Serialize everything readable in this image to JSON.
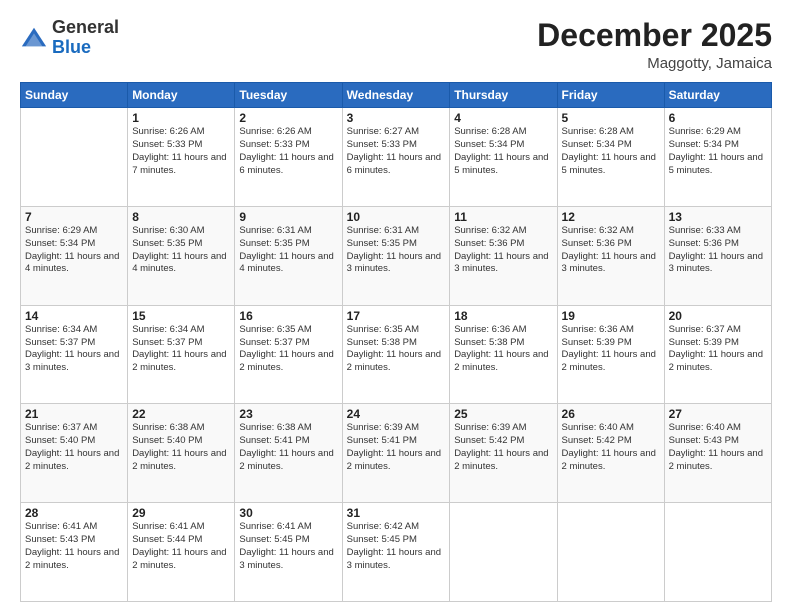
{
  "header": {
    "logo_general": "General",
    "logo_blue": "Blue",
    "month_title": "December 2025",
    "location": "Maggotty, Jamaica"
  },
  "weekdays": [
    "Sunday",
    "Monday",
    "Tuesday",
    "Wednesday",
    "Thursday",
    "Friday",
    "Saturday"
  ],
  "weeks": [
    [
      {
        "day": "",
        "sunrise": "",
        "sunset": "",
        "daylight": ""
      },
      {
        "day": "1",
        "sunrise": "Sunrise: 6:26 AM",
        "sunset": "Sunset: 5:33 PM",
        "daylight": "Daylight: 11 hours and 7 minutes."
      },
      {
        "day": "2",
        "sunrise": "Sunrise: 6:26 AM",
        "sunset": "Sunset: 5:33 PM",
        "daylight": "Daylight: 11 hours and 6 minutes."
      },
      {
        "day": "3",
        "sunrise": "Sunrise: 6:27 AM",
        "sunset": "Sunset: 5:33 PM",
        "daylight": "Daylight: 11 hours and 6 minutes."
      },
      {
        "day": "4",
        "sunrise": "Sunrise: 6:28 AM",
        "sunset": "Sunset: 5:34 PM",
        "daylight": "Daylight: 11 hours and 5 minutes."
      },
      {
        "day": "5",
        "sunrise": "Sunrise: 6:28 AM",
        "sunset": "Sunset: 5:34 PM",
        "daylight": "Daylight: 11 hours and 5 minutes."
      },
      {
        "day": "6",
        "sunrise": "Sunrise: 6:29 AM",
        "sunset": "Sunset: 5:34 PM",
        "daylight": "Daylight: 11 hours and 5 minutes."
      }
    ],
    [
      {
        "day": "7",
        "sunrise": "Sunrise: 6:29 AM",
        "sunset": "Sunset: 5:34 PM",
        "daylight": "Daylight: 11 hours and 4 minutes."
      },
      {
        "day": "8",
        "sunrise": "Sunrise: 6:30 AM",
        "sunset": "Sunset: 5:35 PM",
        "daylight": "Daylight: 11 hours and 4 minutes."
      },
      {
        "day": "9",
        "sunrise": "Sunrise: 6:31 AM",
        "sunset": "Sunset: 5:35 PM",
        "daylight": "Daylight: 11 hours and 4 minutes."
      },
      {
        "day": "10",
        "sunrise": "Sunrise: 6:31 AM",
        "sunset": "Sunset: 5:35 PM",
        "daylight": "Daylight: 11 hours and 3 minutes."
      },
      {
        "day": "11",
        "sunrise": "Sunrise: 6:32 AM",
        "sunset": "Sunset: 5:36 PM",
        "daylight": "Daylight: 11 hours and 3 minutes."
      },
      {
        "day": "12",
        "sunrise": "Sunrise: 6:32 AM",
        "sunset": "Sunset: 5:36 PM",
        "daylight": "Daylight: 11 hours and 3 minutes."
      },
      {
        "day": "13",
        "sunrise": "Sunrise: 6:33 AM",
        "sunset": "Sunset: 5:36 PM",
        "daylight": "Daylight: 11 hours and 3 minutes."
      }
    ],
    [
      {
        "day": "14",
        "sunrise": "Sunrise: 6:34 AM",
        "sunset": "Sunset: 5:37 PM",
        "daylight": "Daylight: 11 hours and 3 minutes."
      },
      {
        "day": "15",
        "sunrise": "Sunrise: 6:34 AM",
        "sunset": "Sunset: 5:37 PM",
        "daylight": "Daylight: 11 hours and 2 minutes."
      },
      {
        "day": "16",
        "sunrise": "Sunrise: 6:35 AM",
        "sunset": "Sunset: 5:37 PM",
        "daylight": "Daylight: 11 hours and 2 minutes."
      },
      {
        "day": "17",
        "sunrise": "Sunrise: 6:35 AM",
        "sunset": "Sunset: 5:38 PM",
        "daylight": "Daylight: 11 hours and 2 minutes."
      },
      {
        "day": "18",
        "sunrise": "Sunrise: 6:36 AM",
        "sunset": "Sunset: 5:38 PM",
        "daylight": "Daylight: 11 hours and 2 minutes."
      },
      {
        "day": "19",
        "sunrise": "Sunrise: 6:36 AM",
        "sunset": "Sunset: 5:39 PM",
        "daylight": "Daylight: 11 hours and 2 minutes."
      },
      {
        "day": "20",
        "sunrise": "Sunrise: 6:37 AM",
        "sunset": "Sunset: 5:39 PM",
        "daylight": "Daylight: 11 hours and 2 minutes."
      }
    ],
    [
      {
        "day": "21",
        "sunrise": "Sunrise: 6:37 AM",
        "sunset": "Sunset: 5:40 PM",
        "daylight": "Daylight: 11 hours and 2 minutes."
      },
      {
        "day": "22",
        "sunrise": "Sunrise: 6:38 AM",
        "sunset": "Sunset: 5:40 PM",
        "daylight": "Daylight: 11 hours and 2 minutes."
      },
      {
        "day": "23",
        "sunrise": "Sunrise: 6:38 AM",
        "sunset": "Sunset: 5:41 PM",
        "daylight": "Daylight: 11 hours and 2 minutes."
      },
      {
        "day": "24",
        "sunrise": "Sunrise: 6:39 AM",
        "sunset": "Sunset: 5:41 PM",
        "daylight": "Daylight: 11 hours and 2 minutes."
      },
      {
        "day": "25",
        "sunrise": "Sunrise: 6:39 AM",
        "sunset": "Sunset: 5:42 PM",
        "daylight": "Daylight: 11 hours and 2 minutes."
      },
      {
        "day": "26",
        "sunrise": "Sunrise: 6:40 AM",
        "sunset": "Sunset: 5:42 PM",
        "daylight": "Daylight: 11 hours and 2 minutes."
      },
      {
        "day": "27",
        "sunrise": "Sunrise: 6:40 AM",
        "sunset": "Sunset: 5:43 PM",
        "daylight": "Daylight: 11 hours and 2 minutes."
      }
    ],
    [
      {
        "day": "28",
        "sunrise": "Sunrise: 6:41 AM",
        "sunset": "Sunset: 5:43 PM",
        "daylight": "Daylight: 11 hours and 2 minutes."
      },
      {
        "day": "29",
        "sunrise": "Sunrise: 6:41 AM",
        "sunset": "Sunset: 5:44 PM",
        "daylight": "Daylight: 11 hours and 2 minutes."
      },
      {
        "day": "30",
        "sunrise": "Sunrise: 6:41 AM",
        "sunset": "Sunset: 5:45 PM",
        "daylight": "Daylight: 11 hours and 3 minutes."
      },
      {
        "day": "31",
        "sunrise": "Sunrise: 6:42 AM",
        "sunset": "Sunset: 5:45 PM",
        "daylight": "Daylight: 11 hours and 3 minutes."
      },
      {
        "day": "",
        "sunrise": "",
        "sunset": "",
        "daylight": ""
      },
      {
        "day": "",
        "sunrise": "",
        "sunset": "",
        "daylight": ""
      },
      {
        "day": "",
        "sunrise": "",
        "sunset": "",
        "daylight": ""
      }
    ]
  ]
}
